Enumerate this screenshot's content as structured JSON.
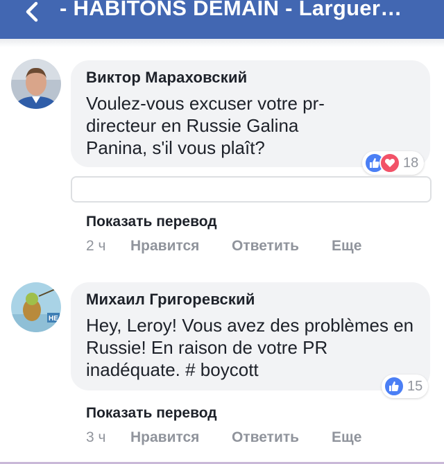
{
  "header": {
    "title": "- HABITONS DEMAIN - Larguer…",
    "back_icon": "chevron-left-icon",
    "bar_color": "#4267b2"
  },
  "comments": [
    {
      "author": "Виктор Мараховский",
      "text": "Voulez-vous excuser votre pr-directeur en Russie Galina Panina, s'il vous plaît?",
      "reactions": {
        "types": [
          "like",
          "love"
        ],
        "count": "18"
      },
      "translate_label": "Показать перевод",
      "time": "2 ч",
      "like_label": "Нравится",
      "reply_label": "Ответить",
      "more_label": "Еще"
    },
    {
      "author": "Михаил Григоревский",
      "text": "Hey, Leroy! Vous avez des problèmes en Russie! En raison de votre PR inadéquate. # boycott",
      "reactions": {
        "types": [
          "like"
        ],
        "count": "15"
      },
      "translate_label": "Показать перевод",
      "time": "3 ч",
      "like_label": "Нравится",
      "reply_label": "Ответить",
      "more_label": "Еще"
    }
  ],
  "colors": {
    "like": "#4b7ff5",
    "love": "#f25268",
    "bubble": "#f2f3f5",
    "meta_text": "#90949c"
  }
}
